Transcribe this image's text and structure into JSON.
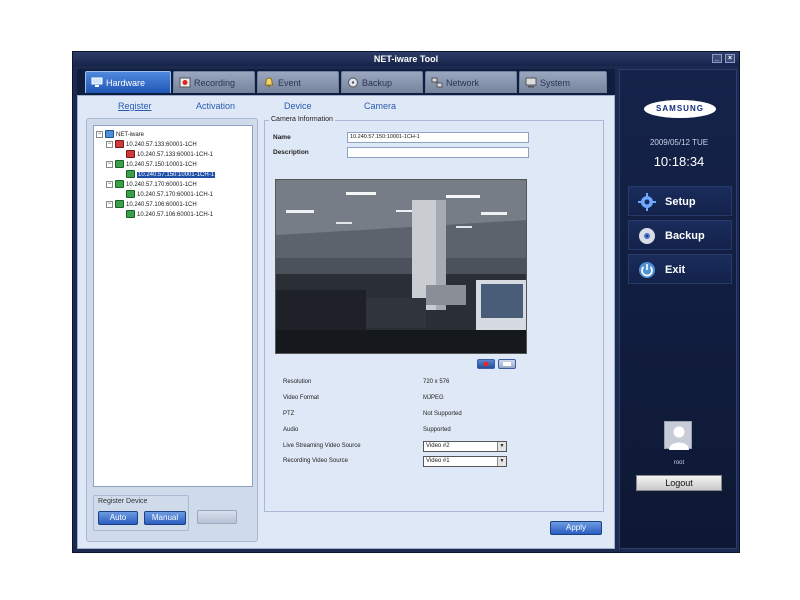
{
  "window": {
    "title": "NET-iware Tool",
    "min": "_",
    "close": "×"
  },
  "tabs": [
    {
      "label": "Hardware",
      "icon": "hardware-icon"
    },
    {
      "label": "Recording",
      "icon": "recording-icon"
    },
    {
      "label": "Event",
      "icon": "event-icon"
    },
    {
      "label": "Backup",
      "icon": "backup-icon"
    },
    {
      "label": "Network",
      "icon": "network-icon"
    },
    {
      "label": "System",
      "icon": "system-icon"
    }
  ],
  "subtabs": [
    "Register",
    "Activation",
    "Device",
    "Camera"
  ],
  "tree": {
    "root": "NET-iware",
    "nodes": [
      "10.240.57.133:60001-1CH",
      "10.240.57.133:60001-1CH-1",
      "10.240.57.150:10001-1CH",
      "10.240.57.150:10001-1CH-1",
      "10.240.57.170:60001-1CH",
      "10.240.57.170:60001-1CH-1",
      "10.240.57.106:60001-1CH",
      "10.240.57.106:60001-1CH-1"
    ]
  },
  "register_device": {
    "label": "Register Device",
    "auto": "Auto",
    "manual": "Manual",
    "third": ""
  },
  "camera_info": {
    "legend": "Camera Information",
    "name_label": "Name",
    "name_value": "10.240.57.150:10001-1CH-1",
    "desc_label": "Description",
    "desc_value": ""
  },
  "info": {
    "resolution_label": "Resolution",
    "resolution_value": "720 x 576",
    "format_label": "Video Format",
    "format_value": "MJPEG",
    "ptz_label": "PTZ",
    "ptz_value": "Not Supported",
    "audio_label": "Audio",
    "audio_value": "Supported",
    "live_label": "Live Streaming Video Source",
    "live_value": "Video #2",
    "rec_label": "Recording Video Source",
    "rec_value": "Video #1"
  },
  "apply": "Apply",
  "sidebar": {
    "logo": "SAMSUNG",
    "date": "2009/05/12 TUE",
    "time": "10:18:34",
    "setup": "Setup",
    "backup": "Backup",
    "exit": "Exit",
    "user": "root",
    "logout": "Logout"
  },
  "colors": {
    "accent": "#1f56b5",
    "frame": "#1b2a4e",
    "panel": "#dfe8f6"
  }
}
